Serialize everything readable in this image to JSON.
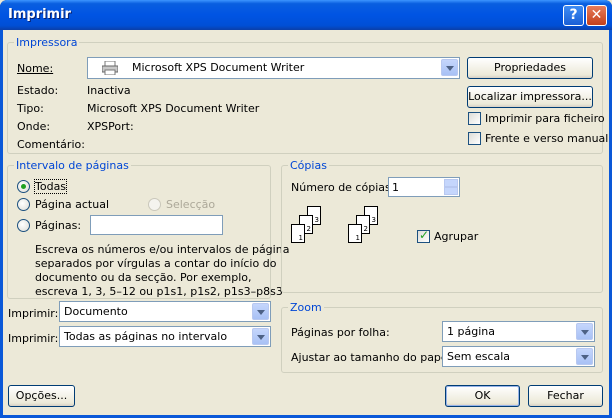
{
  "window": {
    "title": "Imprimir",
    "help_label": "?",
    "close_label": "✕"
  },
  "printer": {
    "legend": "Impressora",
    "name_label": "Nome:",
    "name_value": "Microsoft XPS Document Writer",
    "status_label": "Estado:",
    "status_value": "Inactiva",
    "type_label": "Tipo:",
    "type_value": "Microsoft XPS Document Writer",
    "where_label": "Onde:",
    "where_value": "XPSPort:",
    "comment_label": "Comentário:",
    "properties_button": "Propriedades",
    "find_printer_button": "Localizar impressora...",
    "print_to_file_label": "Imprimir para ficheiro",
    "print_to_file_checked": false,
    "duplex_label": "Frente e verso manual",
    "duplex_checked": false
  },
  "page_range": {
    "legend": "Intervalo de páginas",
    "all_label": "Todas",
    "current_label": "Página actual",
    "selection_label": "Selecção",
    "pages_label": "Páginas:",
    "pages_value": "",
    "selected": "all",
    "help_line1": "Escreva os números e/ou intervalos de página",
    "help_line2": "separados por vírgulas a contar do início do",
    "help_line3": "documento ou da secção. Por exemplo,",
    "help_line4": "escreva 1, 3, 5–12 ou p1s1, p1s2, p1s3–p8s3"
  },
  "print_what": {
    "label": "Imprimir:",
    "value": "Documento"
  },
  "print": {
    "label": "Imprimir:",
    "value": "Todas as páginas no intervalo"
  },
  "copies": {
    "legend": "Cópias",
    "count_label": "Número de cópias:",
    "count_value": "1",
    "collate_label": "Agrupar",
    "collate_checked": true,
    "page_numbers": [
      "1",
      "2",
      "3"
    ]
  },
  "zoom": {
    "legend": "Zoom",
    "pages_per_sheet_label": "Páginas por folha:",
    "pages_per_sheet_value": "1 página",
    "scale_label": "Ajustar ao tamanho do papel:",
    "scale_value": "Sem escala"
  },
  "buttons": {
    "options": "Opções...",
    "ok": "OK",
    "close": "Fechar"
  }
}
